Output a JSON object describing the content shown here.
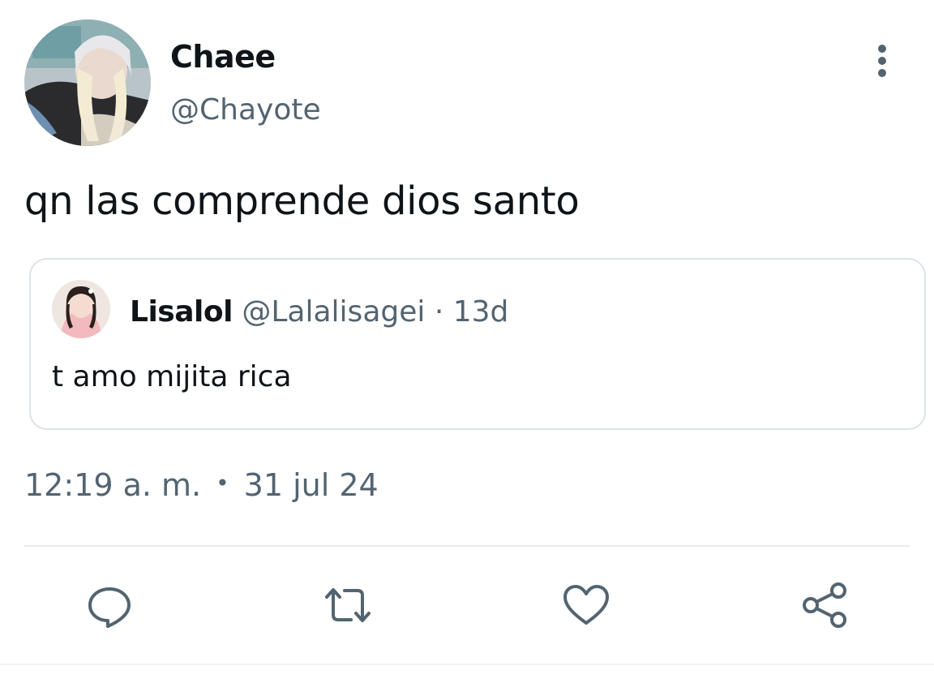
{
  "author": {
    "display_name": "Chaee",
    "handle": "@Chayote",
    "avatar_icon": "profile-photo"
  },
  "tweet": {
    "text": "qn las comprende dios santo",
    "time": "12:19 a. m.",
    "separator": "•",
    "date": "31 jul 24"
  },
  "quoted": {
    "display_name": "Lisalol",
    "handle": "@Lalalisagei",
    "separator": "·",
    "age": "13d",
    "text": "t amo mijita rica",
    "avatar_icon": "profile-photo"
  },
  "actions": [
    {
      "name": "reply",
      "icon": "comment-icon"
    },
    {
      "name": "retweet",
      "icon": "retweet-icon"
    },
    {
      "name": "like",
      "icon": "heart-icon"
    },
    {
      "name": "share",
      "icon": "share-icon"
    }
  ],
  "colors": {
    "text": "#0f1419",
    "secondary": "#536471",
    "border": "#dde3e8"
  }
}
